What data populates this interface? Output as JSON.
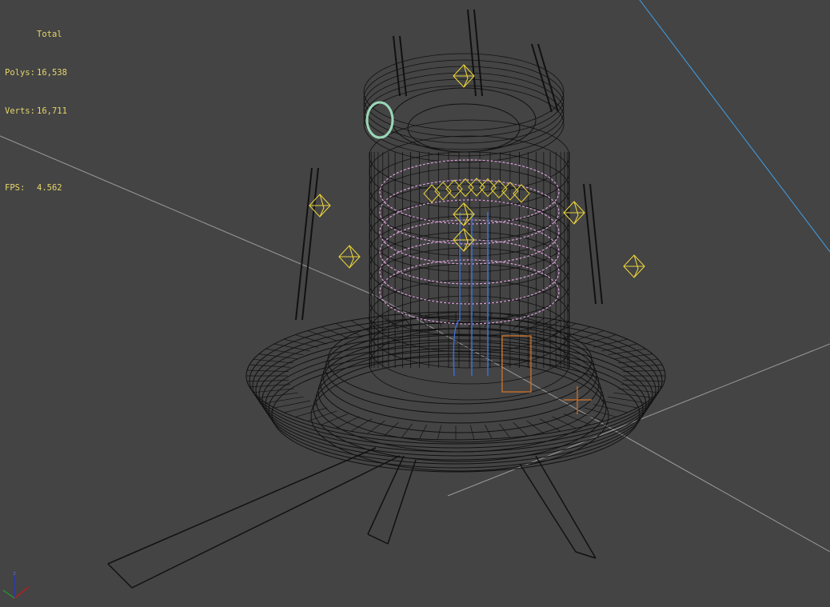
{
  "stats": {
    "header": "Total",
    "polys_label": "Polys:",
    "polys_value": "16,538",
    "verts_label": "Verts:",
    "verts_value": "16,711",
    "fps_label": "FPS:",
    "fps_value": "4.562"
  },
  "axis_gizmo": {
    "z_label": "z"
  },
  "colors": {
    "background": "#444444",
    "stats_text": "#e6d66a",
    "wire": "#111111",
    "light": "#e8d23a",
    "ring": "#d9a0d9",
    "tube": "#3a6fd8",
    "orange": "#d0742a",
    "grid": "#9a9a9a",
    "blue_line": "#3fa0e8"
  }
}
